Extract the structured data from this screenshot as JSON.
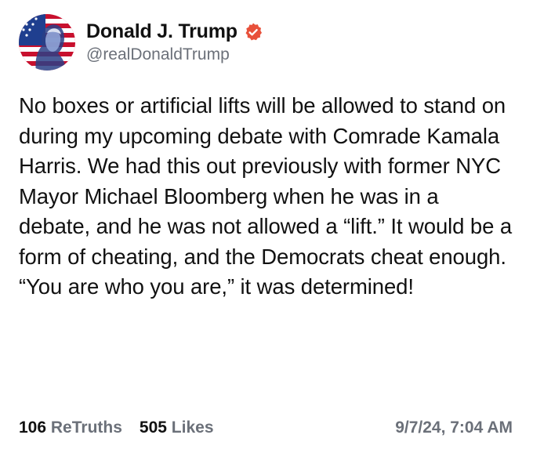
{
  "author": {
    "display_name": "Donald J. Trump",
    "handle": "@realDonaldTrump",
    "verified_icon": "verified-badge-icon",
    "verified_color": "#e8503a",
    "avatar": "flag-portrait-avatar"
  },
  "post": {
    "text": "No boxes or artificial lifts will be allowed to stand on during my upcoming debate with Comrade Kamala Harris. We had this out previously with former NYC Mayor Michael Bloomberg when he was in a debate, and he was not allowed a “lift.” It would be a form of cheating, and the Democrats cheat enough. “You are who you are,” it was determined!"
  },
  "stats": {
    "retruths_count": "106",
    "retruths_label": "ReTruths",
    "likes_count": "505",
    "likes_label": "Likes"
  },
  "timestamp": "9/7/24, 7:04 AM",
  "colors": {
    "text": "#111111",
    "muted": "#6b7079",
    "background": "#ffffff"
  }
}
